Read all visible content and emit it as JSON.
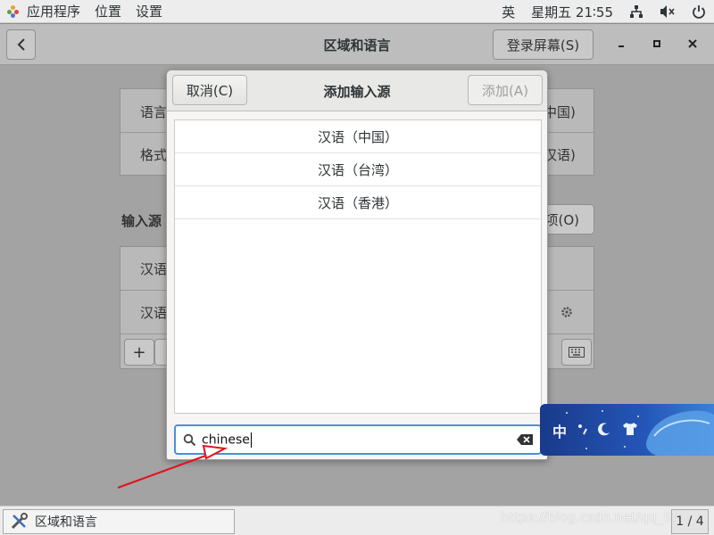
{
  "topbar": {
    "apps_label": "应用程序",
    "places_label": "位置",
    "settings_label": "设置",
    "lang_indicator": "英",
    "clock": "星期五 21∶55"
  },
  "window": {
    "title": "区域和语言",
    "login_screen_button": "登录屏幕(S)",
    "rows": {
      "language_label": "语言",
      "language_value_tail": "中国)",
      "formats_label": "格式",
      "formats_value_tail": "汉语)"
    },
    "input_sources_heading": "输入源",
    "options_button_tail": "项(O)",
    "input_rows": [
      "汉语",
      "汉语"
    ],
    "add_symbol": "+"
  },
  "dialog": {
    "title": "添加输入源",
    "cancel_label": "取消(C)",
    "add_label": "添加(A)",
    "results": [
      "汉语（中国）",
      "汉语（台湾）",
      "汉语（香港）"
    ],
    "search_value": "chinese"
  },
  "ime_toolbar": {
    "mode_label": "中"
  },
  "taskbar": {
    "task_label": "区域和语言",
    "pager": "1 / 4",
    "watermark": "https://blog.csdn.net/qq_5275"
  },
  "colors": {
    "focus_border": "#4a90d9",
    "annotation_arrow": "#e0141e",
    "ime_bg": "#2456b8"
  }
}
